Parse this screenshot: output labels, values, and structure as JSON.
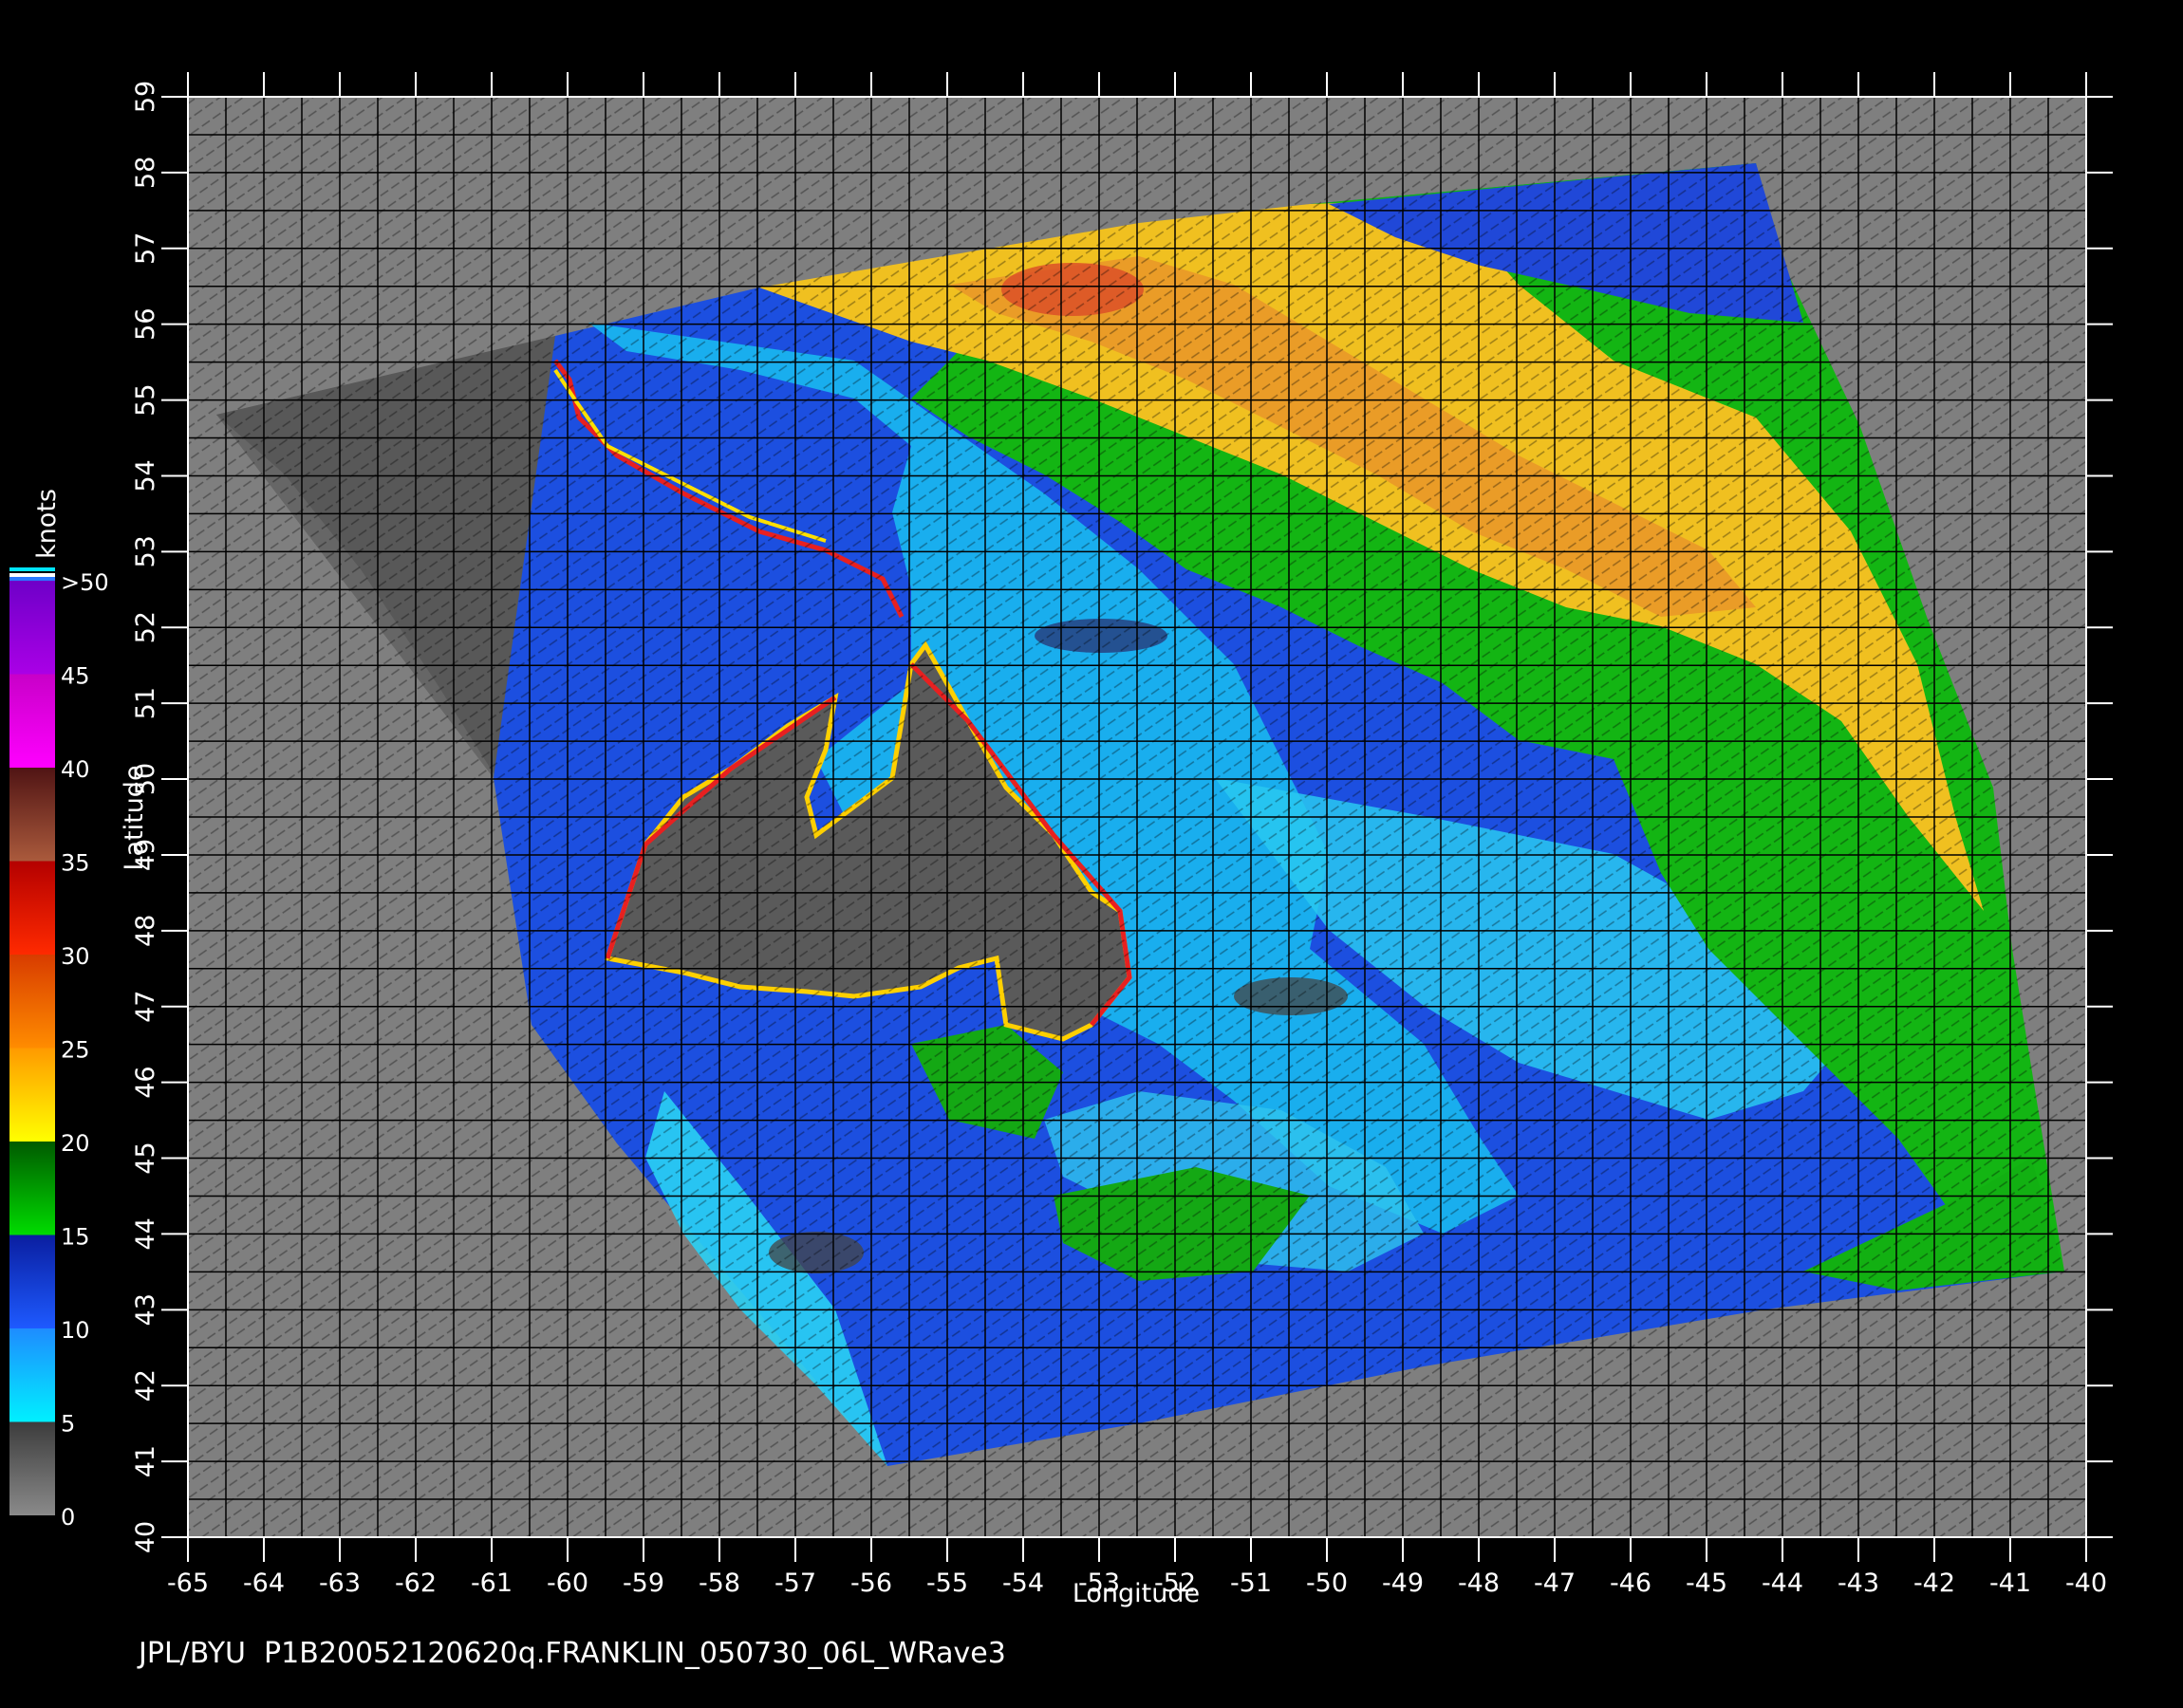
{
  "plot": {
    "xlabel": "Longitude",
    "ylabel": "Latitude",
    "colorbar_title": "knots",
    "footer": "JPL/BYU  P1B20052120620q.FRANKLIN_050730_06L_WRave3",
    "lon_ticks": [
      "-65",
      "-64",
      "-63",
      "-62",
      "-61",
      "-60",
      "-59",
      "-58",
      "-57",
      "-56",
      "-55",
      "-54",
      "-53",
      "-52",
      "-51",
      "-50",
      "-49",
      "-48",
      "-47",
      "-46",
      "-45",
      "-44",
      "-43",
      "-42",
      "-41",
      "-40"
    ],
    "lat_ticks": [
      "40",
      "41",
      "42",
      "43",
      "44",
      "45",
      "46",
      "47",
      "48",
      "49",
      "50",
      "51",
      "52",
      "53",
      "54",
      "55",
      "56",
      "57",
      "58",
      "59"
    ],
    "lon_range": [
      -65,
      -40
    ],
    "lat_range": [
      40,
      59
    ]
  },
  "colorbar": {
    "labels": [
      "0",
      "5",
      "10",
      "15",
      "20",
      "25",
      "30",
      "35",
      "40",
      "45",
      ">50"
    ],
    "bands": [
      {
        "from": 0,
        "to": 5,
        "top": "#3c3c3c",
        "bottom": "#8a8a8a"
      },
      {
        "from": 5,
        "to": 10,
        "top": "#1e8cff",
        "bottom": "#00f0ff"
      },
      {
        "from": 10,
        "to": 15,
        "top": "#0a1ea0",
        "bottom": "#1e5aff"
      },
      {
        "from": 15,
        "to": 20,
        "top": "#005a00",
        "bottom": "#00dc00"
      },
      {
        "from": 20,
        "to": 25,
        "top": "#ff9a00",
        "bottom": "#ffff00"
      },
      {
        "from": 25,
        "to": 30,
        "top": "#d83c00",
        "bottom": "#ff8c00"
      },
      {
        "from": 30,
        "to": 35,
        "top": "#b40000",
        "bottom": "#ff2a00"
      },
      {
        "from": 35,
        "to": 40,
        "top": "#501414",
        "bottom": "#aa5a3c"
      },
      {
        "from": 40,
        "to": 45,
        "top": "#c800c8",
        "bottom": "#ff00ff"
      },
      {
        "from": 45,
        "to": 50,
        "top": "#6e00c8",
        "bottom": "#aa00e6"
      }
    ]
  },
  "colors": {
    "background": "#000000",
    "ocean_no_data": "#7f7f7f",
    "land": "#5a5a5a",
    "grid": "#000000"
  }
}
